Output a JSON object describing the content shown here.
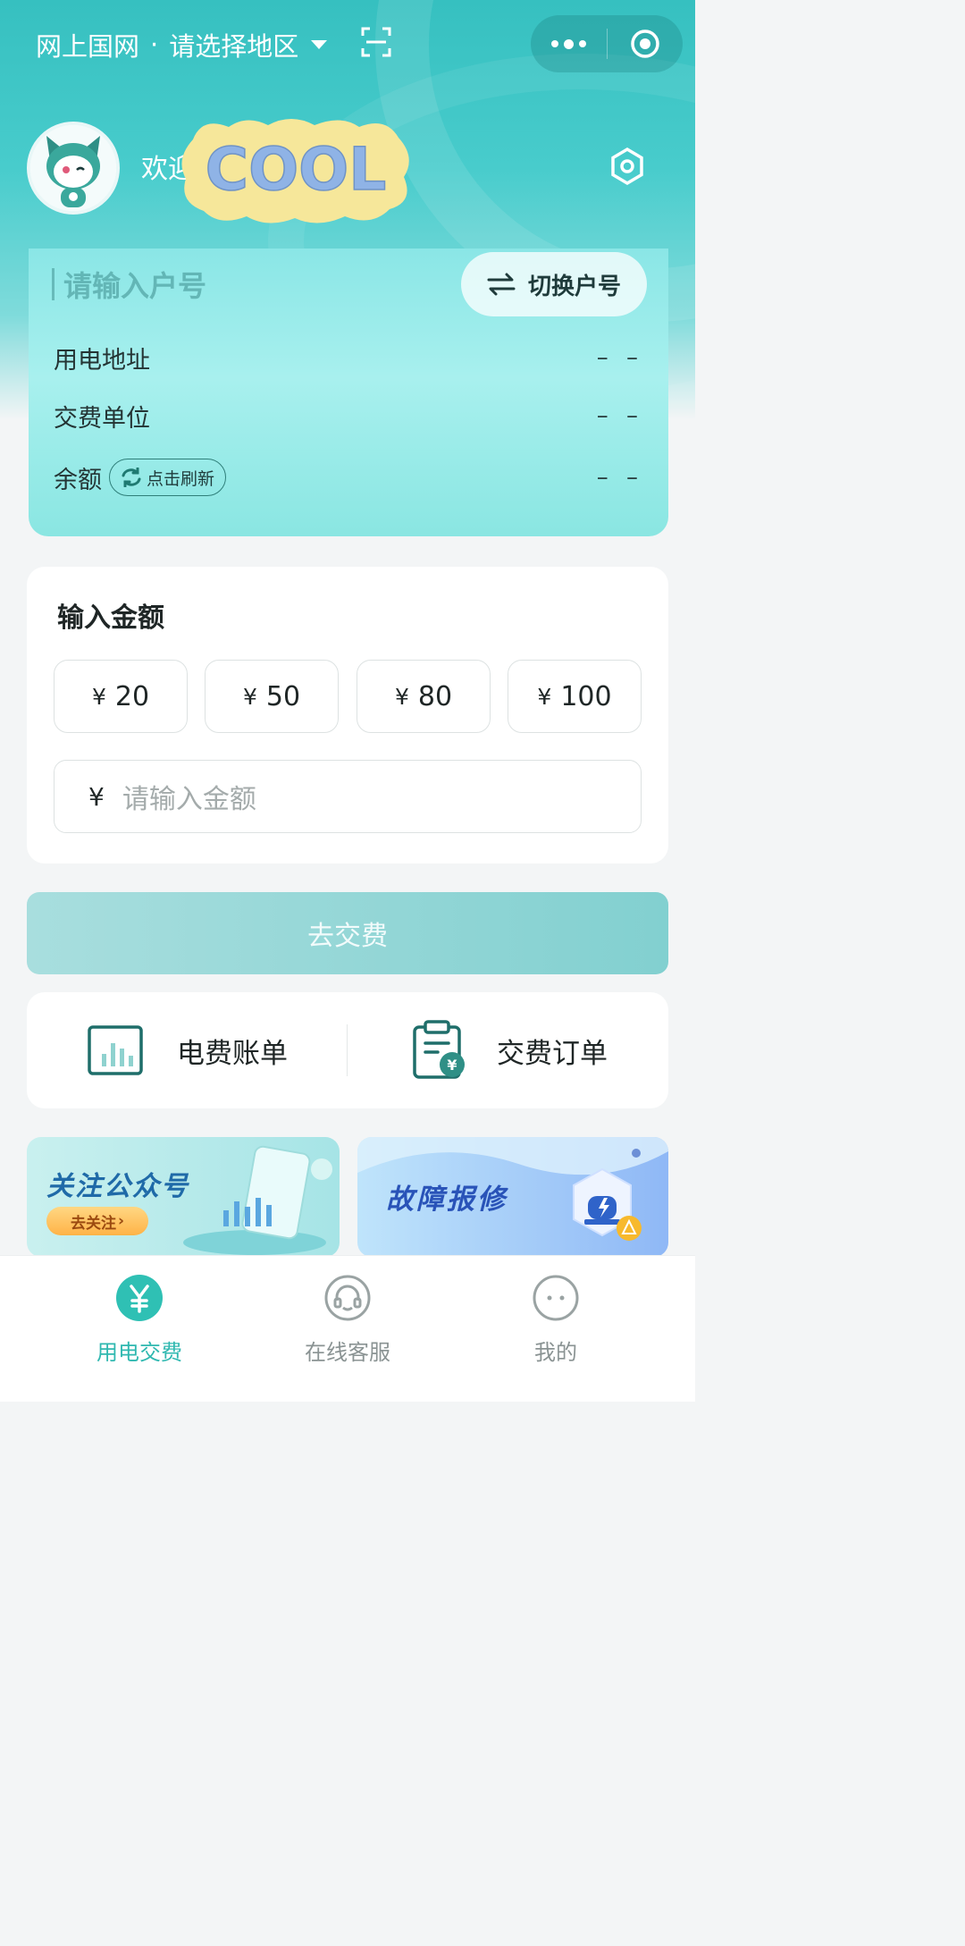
{
  "header": {
    "region_prefix": "网上国网",
    "region_dot": "·",
    "region_label": "请选择地区",
    "welcome": "欢迎使用网上国网",
    "sticker_text": "COOL"
  },
  "account": {
    "input_placeholder": "请输入户号",
    "switch_label": "切换户号",
    "rows": [
      {
        "label": "用电地址",
        "value": "– –"
      },
      {
        "label": "交费单位",
        "value": "– –"
      },
      {
        "label": "余额",
        "value": "– –"
      }
    ],
    "refresh_label": "点击刷新"
  },
  "amount": {
    "title": "输入金额",
    "currency": "¥",
    "presets": [
      "20",
      "50",
      "80",
      "100"
    ],
    "input_placeholder": "请输入金额"
  },
  "pay_button": "去交费",
  "quick_links": [
    {
      "label": "电费账单",
      "icon": "bar-chart-icon"
    },
    {
      "label": "交费订单",
      "icon": "clipboard-yuan-icon"
    }
  ],
  "banners": [
    {
      "title": "关注公众号",
      "cta": "去关注"
    },
    {
      "title": "故障报修"
    }
  ],
  "tabs": [
    {
      "label": "用电交费",
      "icon": "yuan-icon",
      "active": true
    },
    {
      "label": "在线客服",
      "icon": "headset-icon",
      "active": false
    },
    {
      "label": "我的",
      "icon": "smile-icon",
      "active": false
    }
  ],
  "colors": {
    "accent": "#2fb8b0",
    "pay_button": "#8fd4d4",
    "hero": "#3fc5c5"
  }
}
